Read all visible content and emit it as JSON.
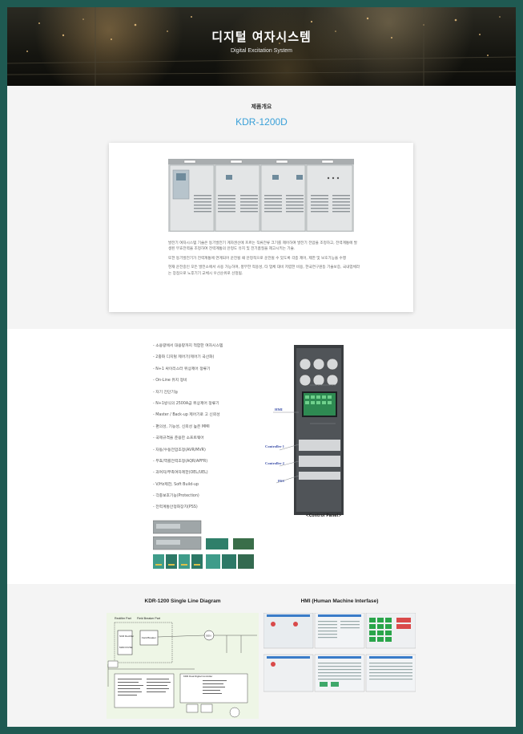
{
  "hero": {
    "title": "디지털 여자시스템",
    "subtitle": "Digital Excitation System"
  },
  "overview": {
    "section_label": "제품개요",
    "model": "KDR-1200D",
    "paragraphs": [
      "발전기 여자시스템 기술은 동기발전기 계자권선에 흐르는 직류전류 크기를 제어하여 발전기 전압을 조정하고, 전력계통에 발생된 무효전력을 조정하여 전력계통의 안정도 유지 및 전기품질을 제고시키는 기술.",
      "또한 동기발전기가 전력계통에 연계되어 운전될 때 안정적으로 운전될 수 있도록 각종 제어, 제한 및 보호기능을 수행",
      "현재 운전중인 모든 발전소에서 사용 가능하며, 풍부한 적용성, 타 업체 대비 저렴한 비용, 한국연구원등 기술보증, 국내업체라는 장점으로 노후기기 교체시 우선순위로 선정됨."
    ]
  },
  "features": {
    "items": [
      "소용량에서 대용량까지 적합한 여자시스템",
      "2중화 디지털 제어기(제어기 국산화)",
      "N+1 싸이리스터 위상제어 정류기",
      "On-Line 유지 정비",
      "자기 진단기능",
      "N+1방식의 2500A급 위상제어 정류기",
      "Master / Back-up 제어기로 고 신뢰성",
      "편의성, 기능성, 신뢰성 높은 MMI",
      "국제규격을 준용한 소프트웨어",
      "자동/수동전압조정(AVR/MVR)",
      "무효/역률전력조정(AQR/APFR)",
      "과여자/부족여자제한(OEL/UEL)",
      "V/Hz제한, Soft Build-up",
      "각종보호기능(Protection)",
      "전력계통안정화장치(PSS)"
    ],
    "panel_labels": {
      "hmi": "HMI",
      "controller1": "Controller 1",
      "controller2": "Controller 2",
      "pss": "PSS"
    },
    "panel_caption": "<Control Panel>"
  },
  "diagrams": {
    "single_line_title": "KDR-1200 Single Line Diagram",
    "hmi_title": "HMI (Human Machine Interfase)",
    "diagram_labels": {
      "rectifier_part": "Rectifier Part",
      "field_breaker_part": "Field Breaker Part",
      "field_breaker": "Field Breaker",
      "scr_rectifier": "SCR Rectifier",
      "main_fuse": "MAIN FUSE",
      "gen": "GEN",
      "controller": "KDR Dual Digital Controller"
    }
  },
  "colors": {
    "border": "#1f5a52",
    "accent": "#3aa0d8",
    "label_blue": "#3b4fa8"
  }
}
